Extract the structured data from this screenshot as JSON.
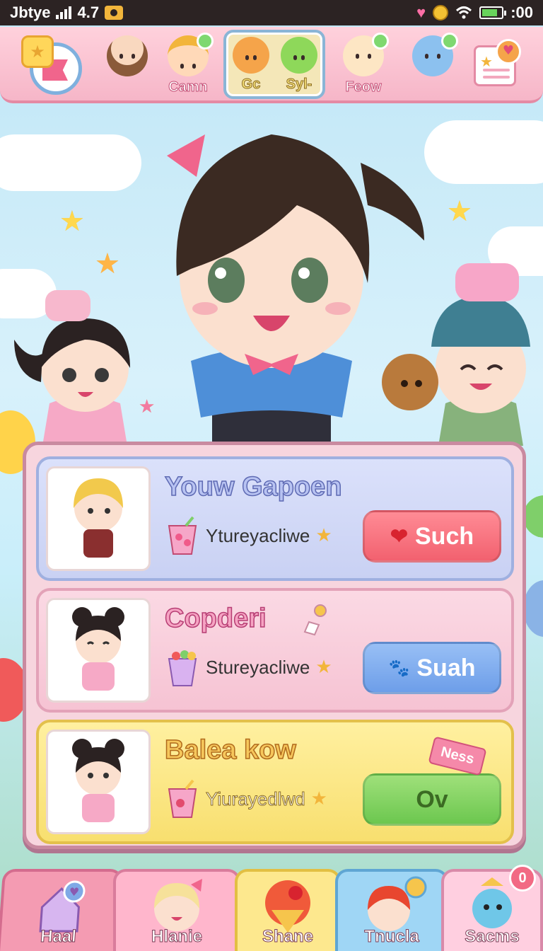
{
  "status_bar": {
    "carrier": "Jbtye",
    "network": "4.7",
    "time": ":00"
  },
  "top_bar": {
    "characters": [
      {
        "label": ""
      },
      {
        "label": "Camn"
      },
      {
        "label": "Gc"
      },
      {
        "label": "Syl-"
      },
      {
        "label": "Feow"
      },
      {
        "label": ""
      }
    ]
  },
  "list": {
    "items": [
      {
        "name": "Youw Gapoen",
        "subtitle": "Ytureyacliwe",
        "action_label": "Such",
        "action_icon": "hearts-icon"
      },
      {
        "name": "Copderi",
        "subtitle": "Stureyacliwe",
        "action_label": "Suah",
        "action_icon": "pets-icon"
      },
      {
        "name": "Balea kow",
        "subtitle": "Yiurayedlwd",
        "action_label": "Ov",
        "action_icon": "",
        "tag": "Ness"
      }
    ]
  },
  "bottom_nav": {
    "items": [
      {
        "label": "Haal"
      },
      {
        "label": "Hlanie"
      },
      {
        "label": "Shane"
      },
      {
        "label": "Tnucla"
      },
      {
        "label": "Sacms",
        "badge": "0"
      }
    ]
  },
  "colors": {
    "top_bar_bg": "#f6b6c8",
    "panel_bg": "#f7d5de",
    "card1_bg": "#c9d1f3",
    "card2_bg": "#f6c3d3",
    "card3_bg": "#f8df6f",
    "button_red": "#f2616f",
    "button_blue": "#6d9ee9",
    "button_green": "#6cc74f"
  }
}
